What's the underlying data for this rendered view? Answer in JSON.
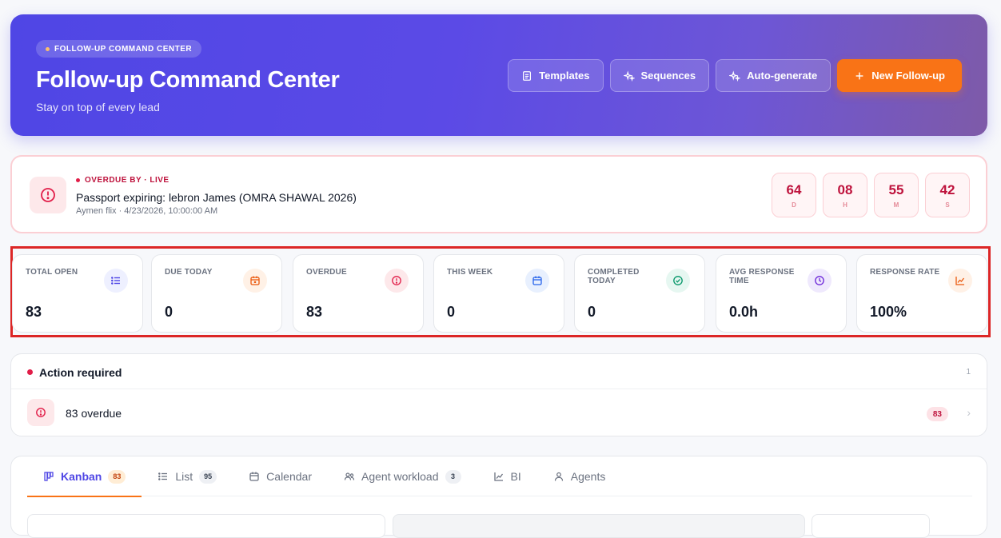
{
  "hero": {
    "eyebrow": "FOLLOW-UP COMMAND CENTER",
    "title": "Follow-up Command Center",
    "subtitle": "Stay on top of every lead",
    "buttons": {
      "templates": "Templates",
      "sequences": "Sequences",
      "auto_generate": "Auto-generate",
      "new_followup": "New Follow-up"
    }
  },
  "overdue": {
    "label": "OVERDUE BY · LIVE",
    "title": "Passport expiring: lebron James (OMRA SHAWAL 2026)",
    "meta": "Aymen flix · 4/23/2026, 10:00:00 AM",
    "countdown": [
      {
        "value": "64",
        "unit": "D"
      },
      {
        "value": "08",
        "unit": "H"
      },
      {
        "value": "55",
        "unit": "M"
      },
      {
        "value": "42",
        "unit": "S"
      }
    ]
  },
  "stats": [
    {
      "label": "TOTAL OPEN",
      "value": "83",
      "icon": "list-icon",
      "color": "#4f46e5",
      "bg": "#eef0ff"
    },
    {
      "label": "DUE TODAY",
      "value": "0",
      "icon": "calendar-today-icon",
      "color": "#ea580c",
      "bg": "#fff1e6"
    },
    {
      "label": "OVERDUE",
      "value": "83",
      "icon": "alert-circle-icon",
      "color": "#e11d48",
      "bg": "#fde8ea"
    },
    {
      "label": "THIS WEEK",
      "value": "0",
      "icon": "calendar-icon",
      "color": "#2563eb",
      "bg": "#e8f0fe"
    },
    {
      "label": "COMPLETED TODAY",
      "value": "0",
      "icon": "check-circle-icon",
      "color": "#059669",
      "bg": "#e6f7f1"
    },
    {
      "label": "AVG RESPONSE TIME",
      "value": "0.0h",
      "icon": "clock-icon",
      "color": "#6d28d9",
      "bg": "#efe9fd"
    },
    {
      "label": "RESPONSE RATE",
      "value": "100%",
      "icon": "trend-chart-icon",
      "color": "#ea580c",
      "bg": "#fff1e6"
    }
  ],
  "action": {
    "title": "Action required",
    "count": "1",
    "item_text": "83 overdue",
    "item_badge": "83"
  },
  "tabs": [
    {
      "label": "Kanban",
      "badge": "83",
      "icon": "kanban-icon",
      "active": true
    },
    {
      "label": "List",
      "badge": "95",
      "icon": "list-icon",
      "active": false
    },
    {
      "label": "Calendar",
      "badge": "",
      "icon": "calendar-icon",
      "active": false
    },
    {
      "label": "Agent workload",
      "badge": "3",
      "icon": "users-icon",
      "active": false
    },
    {
      "label": "BI",
      "badge": "",
      "icon": "chart-icon",
      "active": false
    },
    {
      "label": "Agents",
      "badge": "",
      "icon": "user-icon",
      "active": false
    }
  ]
}
